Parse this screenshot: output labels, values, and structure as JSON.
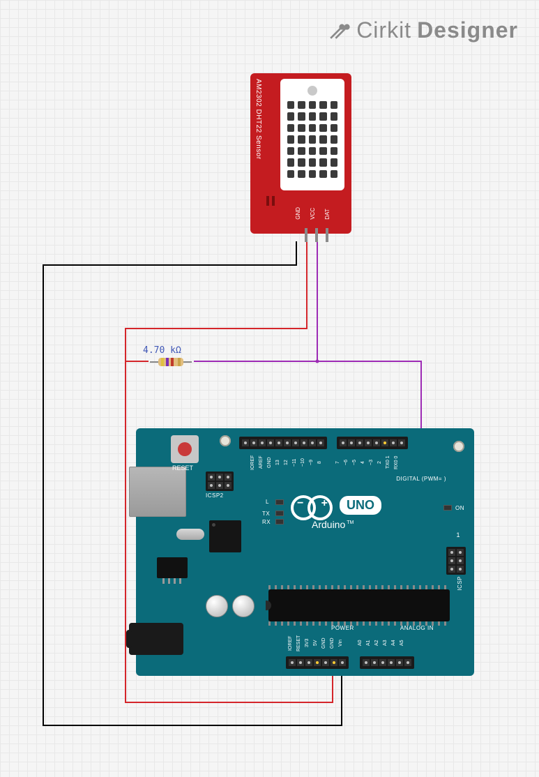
{
  "brand": {
    "name1": "Cirkit",
    "name2": "Designer"
  },
  "sensor": {
    "name": "AM2302 DHT22 Sensor",
    "pins": [
      "GND",
      "VCC",
      "DAT"
    ]
  },
  "resistor": {
    "value": "4.70 kΩ"
  },
  "arduino": {
    "reset_label": "RESET",
    "icsp2_label": "ICSP2",
    "icsp_label": "ICSP",
    "led_labels": {
      "l": "L",
      "tx": "TX",
      "rx": "RX",
      "on": "ON"
    },
    "logo_text": "Arduino",
    "logo_tm": "TM",
    "uno": "UNO",
    "one": "1",
    "section_digital": "DIGITAL (PWM=  )",
    "section_power": "POWER",
    "section_analog": "ANALOG IN",
    "top_pins_a": [
      "",
      "IOREF",
      "AREF",
      "GND",
      "13",
      "12",
      "~11",
      "~10",
      "~9",
      "8"
    ],
    "top_pins_b": [
      "7",
      "~6",
      "~5",
      "4",
      "~3",
      "2",
      "1",
      "TX0",
      "RX0"
    ],
    "top_pins_b_alt": [
      "7",
      "~6",
      "~5",
      "4",
      "~3",
      "2",
      "TX0 1",
      "RX0 0"
    ],
    "bottom_pins_power": [
      "IOREF",
      "RESET",
      "3V3",
      "5V",
      "GND",
      "GND",
      "Vin"
    ],
    "bottom_pins_analog": [
      "A0",
      "A1",
      "A2",
      "A3",
      "A4",
      "A5"
    ]
  },
  "wires": [
    {
      "name": "GND",
      "color": "#000000",
      "from": "DHT22.GND",
      "to": "Arduino.GND"
    },
    {
      "name": "VCC",
      "color": "#d4252a",
      "from": "DHT22.VCC",
      "to": "Arduino.5V"
    },
    {
      "name": "DATA",
      "color": "#9d2bb5",
      "from": "DHT22.DAT",
      "to": "Arduino.D2"
    },
    {
      "name": "PULLUP",
      "component": "Resistor 4.70 kΩ",
      "between": [
        "DATA",
        "VCC"
      ]
    }
  ]
}
